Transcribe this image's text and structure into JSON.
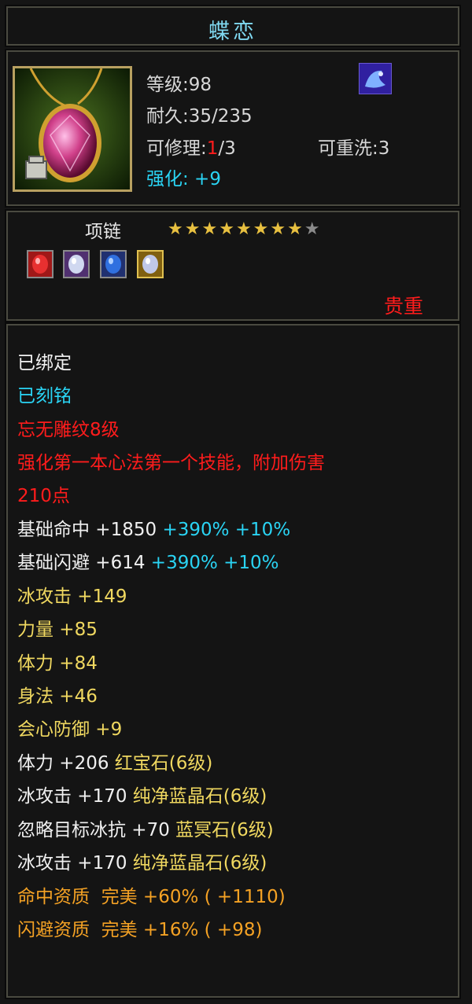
{
  "item": {
    "name": "蝶恋",
    "level": "等级:98",
    "durability": "耐久:35/235",
    "repair_prefix": "可修理:",
    "repair_used": "1",
    "repair_total": "/3",
    "rewash": "可重洗:3",
    "enhance": "强化: +9",
    "type": "项链",
    "stars": {
      "filled": 8,
      "total": 9
    },
    "gems": [
      "red-gem-icon",
      "white-gem-icon",
      "blue-gem-icon",
      "yellow-gem-icon"
    ],
    "rarity": "贵重"
  },
  "attributes": {
    "bound": "已绑定",
    "engraved": "已刻铭",
    "carving": "忘无雕纹8级",
    "carving_effect_1": "强化第一本心法第一个技能，附加伤害",
    "carving_effect_2": "210点"
  },
  "stats": [
    {
      "label": "基础命中 +1850",
      "extra": "+390% +10%"
    },
    {
      "label": "基础闪避 +614",
      "extra": "+390% +10%"
    },
    {
      "label": "冰攻击 +149"
    },
    {
      "label": "力量 +85"
    },
    {
      "label": "体力 +84"
    },
    {
      "label": "身法 +46"
    },
    {
      "label": "会心防御 +9"
    }
  ],
  "gem_stats": [
    {
      "label": "体力 +206",
      "gem": "红宝石(6级)"
    },
    {
      "label": "冰攻击 +170",
      "gem": "纯净蓝晶石(6级)"
    },
    {
      "label": "忽略目标冰抗 +70",
      "gem": "蓝冥石(6级)"
    },
    {
      "label": "冰攻击 +170",
      "gem": "纯净蓝晶石(6级)"
    }
  ],
  "aptitudes": [
    "命中资质  完美 +60% ( +1110)",
    "闪避资质  完美 +16% ( +98)"
  ],
  "colors": {
    "title": "#7fd8f0",
    "cyan": "#2ad4f4",
    "red": "#ff1c1c",
    "yellow": "#f0d860",
    "orange": "#f5a224",
    "star": "#e8c040"
  }
}
